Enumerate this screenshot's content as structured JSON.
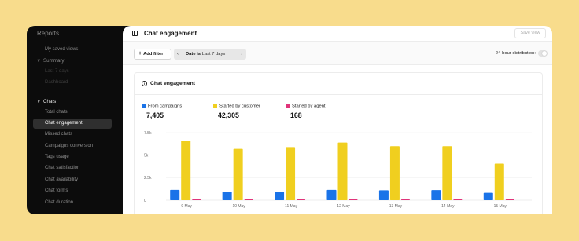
{
  "sidebar": {
    "title": "Reports",
    "items_top": [
      {
        "label": "My saved views"
      }
    ],
    "summary": {
      "label": "Summary",
      "items": [
        "Last 7 days",
        "Dashboard"
      ]
    },
    "chats": {
      "label": "Chats",
      "items": [
        "Total chats",
        "Chat engagement",
        "Missed chats",
        "Campaigns conversion",
        "Tags usage",
        "Chat satisfaction",
        "Chat availability",
        "Chat forms",
        "Chat duration"
      ],
      "active": "Chat engagement"
    }
  },
  "header": {
    "title": "Chat engagement",
    "save_view": "Save view"
  },
  "toolbar": {
    "add_filter": "Add filter",
    "date_key": "Date is",
    "date_value": "Last 7 days",
    "distribution_label": "24-hour distribution:"
  },
  "card": {
    "title": "Chat engagement"
  },
  "colors": {
    "campaigns": "#1a73e8",
    "customer": "#f0cf1f",
    "agent": "#e0347a"
  },
  "chart_data": {
    "type": "bar",
    "categories": [
      "9 May",
      "10 May",
      "11 May",
      "12 May",
      "13 May",
      "14 May",
      "15 May"
    ],
    "series": [
      {
        "name": "From campaigns",
        "total": "7,405",
        "values": [
          1150,
          950,
          920,
          1150,
          1100,
          1120,
          820
        ]
      },
      {
        "name": "Started by customer",
        "total": "42,305",
        "values": [
          6600,
          5700,
          5900,
          6400,
          6000,
          6000,
          4050
        ]
      },
      {
        "name": "Started by agent",
        "total": "168",
        "values": [
          24,
          24,
          24,
          24,
          24,
          24,
          24
        ]
      }
    ],
    "yticks": [
      "7.5k",
      "5k",
      "2.5k",
      "0"
    ],
    "ylim": [
      0,
      7500
    ],
    "xlabel": "",
    "ylabel": ""
  }
}
